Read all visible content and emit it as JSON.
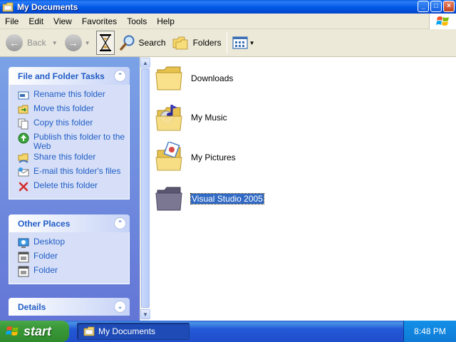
{
  "window": {
    "title": "My Documents",
    "buttons": [
      "_",
      "□",
      "×"
    ]
  },
  "menu": [
    "File",
    "Edit",
    "View",
    "Favorites",
    "Tools",
    "Help"
  ],
  "toolbar": {
    "back_label": "Back",
    "search_label": "Search",
    "folders_label": "Folders"
  },
  "task_pane": {
    "file_folder_tasks": {
      "title": "File and Folder Tasks",
      "items": [
        {
          "label": "Rename this folder",
          "icon": "rename-icon"
        },
        {
          "label": "Move this folder",
          "icon": "move-icon"
        },
        {
          "label": "Copy this folder",
          "icon": "copy-icon"
        },
        {
          "label": "Publish this folder to the Web",
          "icon": "publish-web-icon"
        },
        {
          "label": "Share this folder",
          "icon": "share-icon"
        },
        {
          "label": "E-mail this folder's files",
          "icon": "email-icon"
        },
        {
          "label": "Delete this folder",
          "icon": "delete-icon"
        }
      ]
    },
    "other_places": {
      "title": "Other Places",
      "items": [
        {
          "label": "Desktop",
          "icon": "desktop-icon"
        },
        {
          "label": "Folder",
          "icon": "folder-window-icon"
        },
        {
          "label": "Folder",
          "icon": "folder-window-icon"
        }
      ]
    },
    "details": {
      "title": "Details"
    }
  },
  "files": [
    {
      "name": "Downloads",
      "icon": "folder-icon",
      "selected": false
    },
    {
      "name": "My Music",
      "icon": "music-folder-icon",
      "selected": false
    },
    {
      "name": "My Pictures",
      "icon": "pictures-folder-icon",
      "selected": false
    },
    {
      "name": "Visual Studio 2005",
      "icon": "dark-folder-icon",
      "selected": true
    }
  ],
  "taskbar": {
    "start_label": "start",
    "window_label": "My Documents",
    "clock": "8:48 PM"
  },
  "colors": {
    "titlebar": "#0058e6",
    "task_link": "#215dc6",
    "selection": "#316ac5",
    "start_green": "#3c9a3a"
  }
}
